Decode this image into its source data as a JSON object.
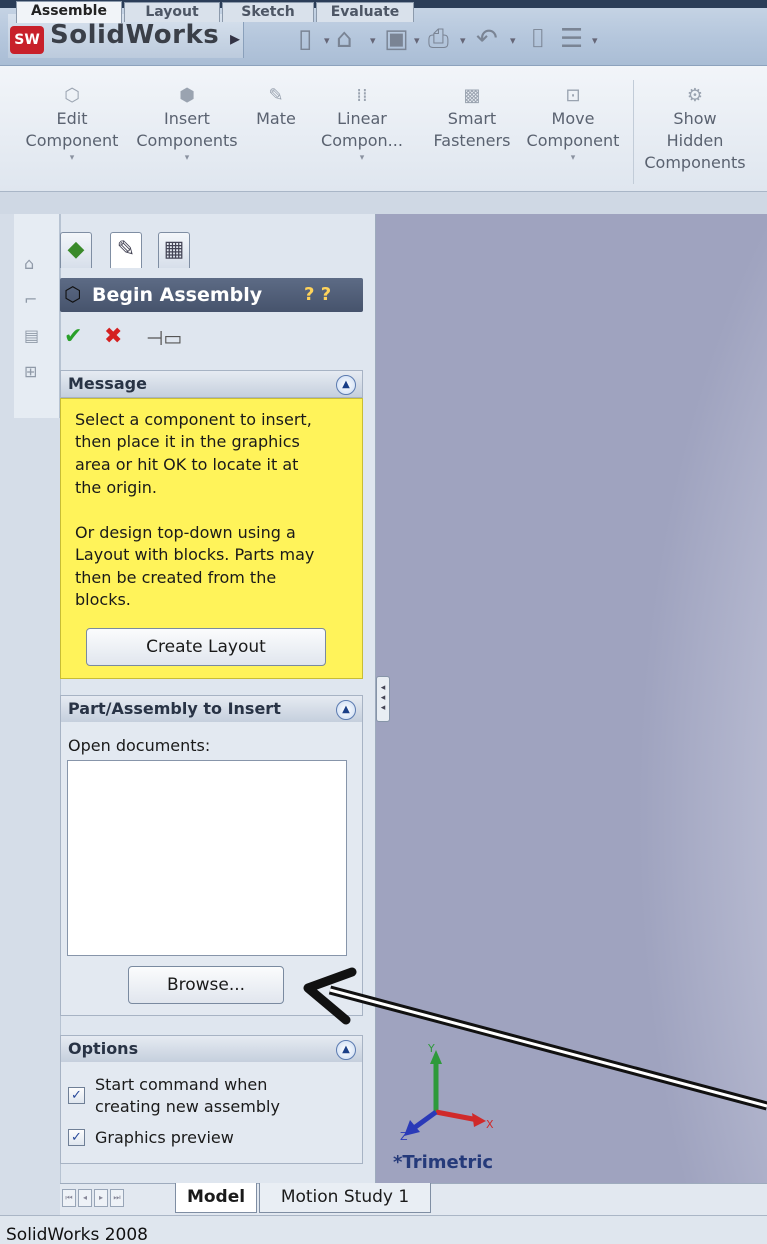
{
  "app": {
    "badge": "SW",
    "title": "SolidWorks"
  },
  "ribbon": {
    "buttons": [
      {
        "line1": "Edit",
        "line2": "Component",
        "line3": ""
      },
      {
        "line1": "Insert",
        "line2": "Components",
        "line3": ""
      },
      {
        "line1": "Mate",
        "line2": "",
        "line3": ""
      },
      {
        "line1": "Linear",
        "line2": "Compon...",
        "line3": ""
      },
      {
        "line1": "Smart",
        "line2": "Fasteners",
        "line3": ""
      },
      {
        "line1": "Move",
        "line2": "Component",
        "line3": ""
      },
      {
        "line1": "Show",
        "line2": "Hidden",
        "line3": "Components"
      }
    ]
  },
  "command_tabs": [
    "Assemble",
    "Layout",
    "Sketch",
    "Evaluate"
  ],
  "property_manager": {
    "title": "Begin Assembly",
    "message_group": {
      "header": "Message",
      "lines": [
        "Select a component to insert,",
        "then place it in the graphics",
        "area or hit OK to locate it at",
        "the origin.",
        "",
        "Or design top-down using a",
        "Layout with blocks. Parts may",
        "then be created from the",
        "blocks."
      ],
      "button": "Create Layout"
    },
    "insert_group": {
      "header": "Part/Assembly to Insert",
      "label": "Open documents:",
      "browse_button": "Browse..."
    },
    "options_group": {
      "header": "Options",
      "start_command_line1": "Start command when",
      "start_command_line2": "creating new assembly",
      "graphics_preview": "Graphics preview"
    }
  },
  "viewport": {
    "view_name": "*Trimetric",
    "axis_x": "X",
    "axis_y": "Y",
    "axis_z": "Z"
  },
  "bottom_tabs": {
    "model": "Model",
    "motion": "Motion Study 1"
  },
  "status": {
    "text": "SolidWorks 2008"
  },
  "colors": {
    "message_bg": "#fff35a",
    "header_bg": "#4f5c76",
    "ok": "#2aa02a",
    "cancel": "#d42020"
  }
}
